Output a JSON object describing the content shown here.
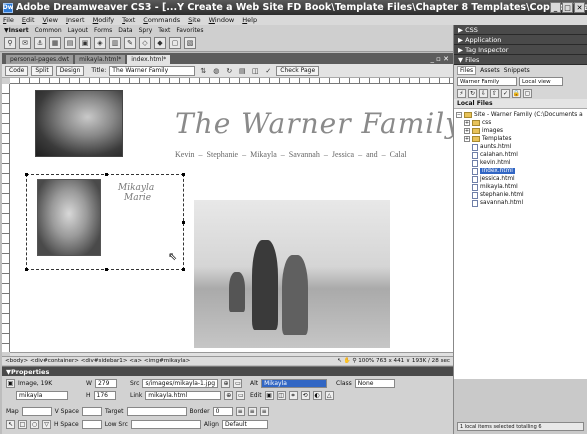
{
  "window": {
    "title": "Adobe Dreamweaver CS3 - [...Y Create a Web Site FD Book\\Template Files\\Chapter 8 Templates\\Copy of Warner site bac..."
  },
  "menu": [
    "File",
    "Edit",
    "View",
    "Insert",
    "Modify",
    "Text",
    "Commands",
    "Site",
    "Window",
    "Help"
  ],
  "insert_bar": {
    "label": "▼Insert",
    "tabs": [
      "Common",
      "Layout",
      "Forms",
      "Data",
      "Spry",
      "Text",
      "Favorites"
    ],
    "icons": [
      "link-icon",
      "email-icon",
      "anchor-icon",
      "table-icon",
      "div-icon",
      "image-icon",
      "media-icon",
      "date-icon",
      "comment-icon",
      "head-icon",
      "script-icon",
      "template-icon",
      "tag-chooser-icon"
    ]
  },
  "document": {
    "tabs": [
      "personal-pages.dwt",
      "mikayla.html*",
      "index.html*"
    ],
    "active_tab": "index.html*",
    "view_buttons": [
      "Code",
      "Split",
      "Design"
    ],
    "title_label": "Title:",
    "title_value": "The Warner Family",
    "check_page": "Check Page"
  },
  "page": {
    "site_title": "The Warner Family",
    "nav_text": "Kevin – Stephanie – Mikayla – Savannah – Jessica – and – Calal",
    "signature_line1": "Mikayla",
    "signature_line2": "Marie"
  },
  "status_bar": {
    "tag_path": "<body> <div#container> <div#sidebar1> <a> <img#mikayla>",
    "zoom": "100%",
    "dims": "763 x 441 ∨ 193K / 28 sec"
  },
  "properties": {
    "header": "▼Properties",
    "image_label": "Image, 19K",
    "id_value": "mikayla",
    "w_label": "W",
    "w_value": "279",
    "h_label": "H",
    "h_value": "176",
    "src_label": "Src",
    "src_value": "s/images/mikayla-1.jpg",
    "link_label": "Link",
    "link_value": "mikayla.html",
    "alt_label": "Alt",
    "alt_value": "Mikayla",
    "edit_label": "Edit",
    "class_label": "Class",
    "class_value": "None",
    "map_label": "Map",
    "vspace_label": "V Space",
    "target_label": "Target",
    "border_label": "Border",
    "border_value": "0",
    "hspace_label": "H Space",
    "lowsrc_label": "Low Src",
    "align_label": "Align",
    "align_value": "Default"
  },
  "right_panels": {
    "css": "▶ CSS",
    "application": "▶ Application",
    "tag_inspector": "▶ Tag Inspector",
    "files": "▼ Files",
    "files_tabs": [
      "Files",
      "Assets",
      "Snippets"
    ],
    "site_select": "Warner Family",
    "view_select": "Local view",
    "local_files": "Local Files",
    "tree": [
      {
        "label": "Site - Warner Family (C:\\Documents a",
        "type": "site"
      },
      {
        "label": "css",
        "type": "folder"
      },
      {
        "label": "images",
        "type": "folder"
      },
      {
        "label": "Templates",
        "type": "folder"
      },
      {
        "label": "aunts.html",
        "type": "file"
      },
      {
        "label": "calahan.html",
        "type": "file"
      },
      {
        "label": "kevin.html",
        "type": "file"
      },
      {
        "label": "index.html",
        "type": "file"
      },
      {
        "label": "jessica.html",
        "type": "file"
      },
      {
        "label": "mikayla.html",
        "type": "file"
      },
      {
        "label": "stephanie.html",
        "type": "file"
      },
      {
        "label": "savannah.html",
        "type": "file"
      }
    ],
    "status": "1 local items selected totalling 6"
  }
}
